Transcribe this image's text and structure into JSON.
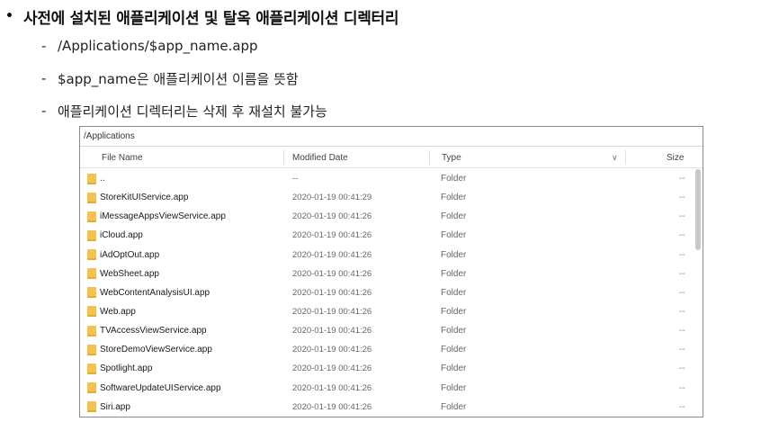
{
  "slide": {
    "title": "사전에 설치된 애플리케이션 및 탈옥 애플리케이션 디렉터리",
    "bullet": "•",
    "dash": "-",
    "sub_items": [
      "/Applications/$app_name.app",
      "$app_name은 애플리케이션 이름을 뜻함",
      "애플리케이션 디렉터리는 삭제 후 재설치 불가능"
    ]
  },
  "explorer": {
    "path": "/Applications",
    "columns": {
      "name": "File Name",
      "modified": "Modified Date",
      "type": "Type",
      "size": "Size"
    },
    "sort_icon": "chevron-down-icon",
    "rows": [
      {
        "name": "..",
        "date": "--",
        "type": "Folder",
        "size": "--"
      },
      {
        "name": "StoreKitUIService.app",
        "date": "2020-01-19 00:41:29",
        "type": "Folder",
        "size": "--"
      },
      {
        "name": "iMessageAppsViewService.app",
        "date": "2020-01-19 00:41:26",
        "type": "Folder",
        "size": "--"
      },
      {
        "name": "iCloud.app",
        "date": "2020-01-19 00:41:26",
        "type": "Folder",
        "size": "--"
      },
      {
        "name": "iAdOptOut.app",
        "date": "2020-01-19 00:41:26",
        "type": "Folder",
        "size": "--"
      },
      {
        "name": "WebSheet.app",
        "date": "2020-01-19 00:41:26",
        "type": "Folder",
        "size": "--"
      },
      {
        "name": "WebContentAnalysisUI.app",
        "date": "2020-01-19 00:41:26",
        "type": "Folder",
        "size": "--"
      },
      {
        "name": "Web.app",
        "date": "2020-01-19 00:41:26",
        "type": "Folder",
        "size": "--"
      },
      {
        "name": "TVAccessViewService.app",
        "date": "2020-01-19 00:41:26",
        "type": "Folder",
        "size": "--"
      },
      {
        "name": "StoreDemoViewService.app",
        "date": "2020-01-19 00:41:26",
        "type": "Folder",
        "size": "--"
      },
      {
        "name": "Spotlight.app",
        "date": "2020-01-19 00:41:26",
        "type": "Folder",
        "size": "--"
      },
      {
        "name": "SoftwareUpdateUIService.app",
        "date": "2020-01-19 00:41:26",
        "type": "Folder",
        "size": "--"
      },
      {
        "name": "Siri.app",
        "date": "2020-01-19 00:41:26",
        "type": "Folder",
        "size": "--"
      }
    ]
  }
}
